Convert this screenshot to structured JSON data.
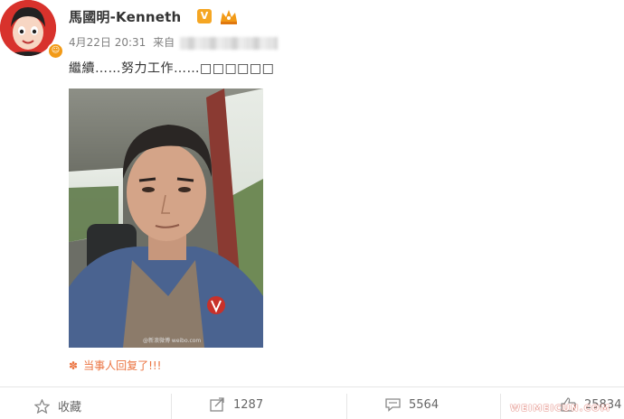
{
  "post": {
    "username": "馬國明-Kenneth",
    "verified_badge": "V",
    "timestamp": "4月22日 20:31",
    "source_prefix": "来自",
    "text": "繼續……努力工作……□□□□□□",
    "reply_text": "当事人回复了!!!",
    "photo_watermark": "@新浪微博 weibo.com"
  },
  "actions": {
    "favorite_label": "收藏",
    "repost_count": "1287",
    "comment_count": "5564",
    "like_count": "25834"
  },
  "site_watermark": "WEIMEICUN.COM",
  "colors": {
    "verified": "#f5a623",
    "reply": "#eb7340",
    "avatar_bg": "#d8322c"
  }
}
